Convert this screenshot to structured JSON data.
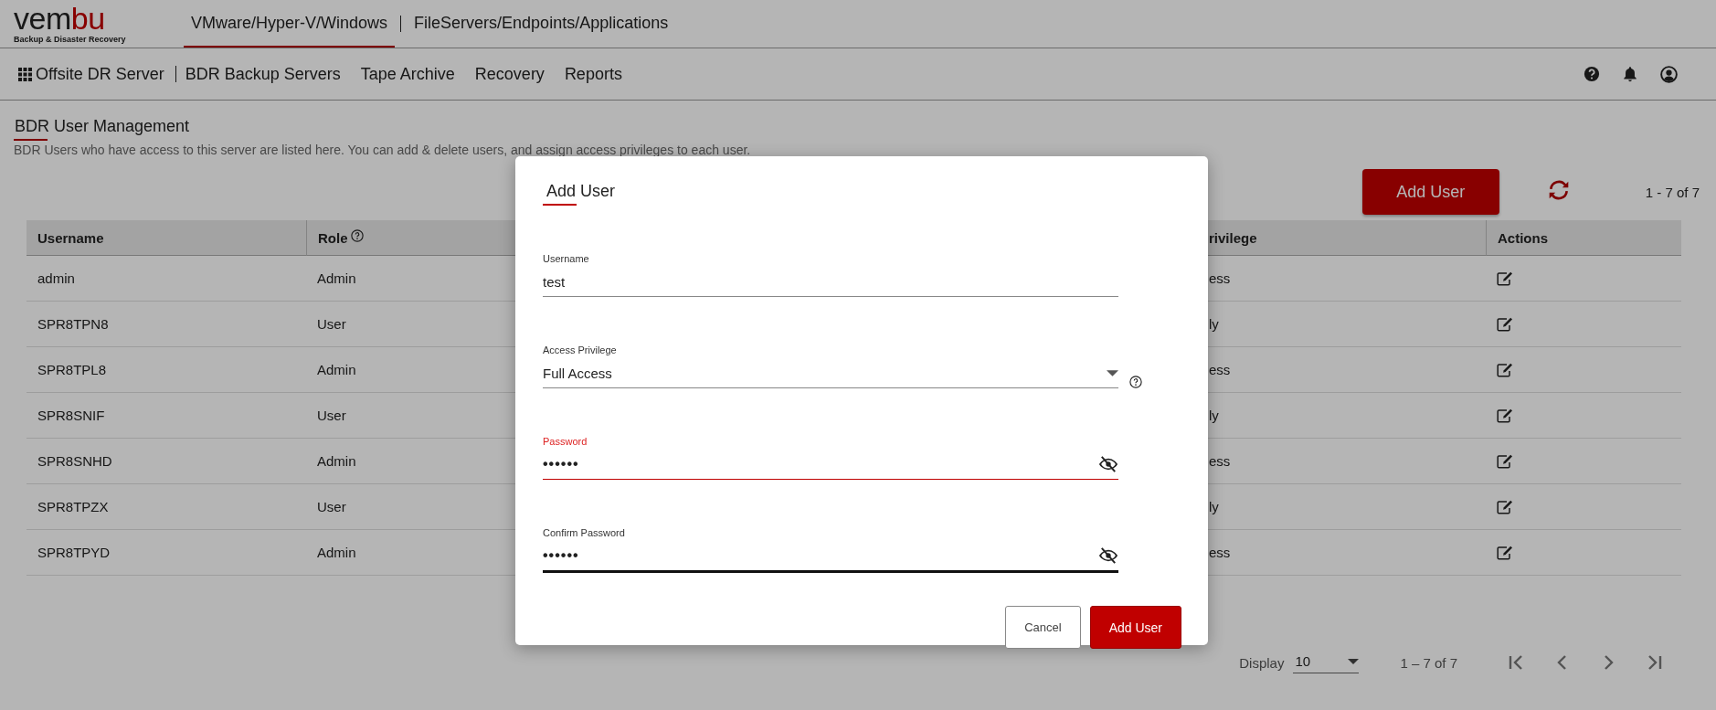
{
  "header": {
    "logo": {
      "parts": [
        "vem",
        "bu"
      ],
      "tagline": "Backup & Disaster Recovery"
    },
    "product_tabs": [
      {
        "label": "VMware/Hyper-V/Windows",
        "selected": true
      },
      {
        "label": "FileServers/Endpoints/Applications",
        "selected": false
      }
    ]
  },
  "nav": {
    "server": "Offsite DR Server",
    "items": [
      "BDR Backup Servers",
      "Tape Archive",
      "Recovery",
      "Reports"
    ]
  },
  "page": {
    "title": "BDR User Management",
    "description": "BDR Users who have access to this server are listed here. You can add & delete users, and assign access privileges to each user.",
    "add_button": "Add User",
    "count": "1 - 7 of 7"
  },
  "table": {
    "columns": [
      {
        "label": "Username",
        "help": false
      },
      {
        "label": "Role",
        "help": true
      },
      {
        "label": "rivilege",
        "help": false
      },
      {
        "label": "Actions",
        "help": false
      }
    ],
    "rows": [
      {
        "username": "admin",
        "role": "Admin",
        "column_3": "ess"
      },
      {
        "username": "SPR8TPN8",
        "role": "User",
        "column_3": "ly"
      },
      {
        "username": "SPR8TPL8",
        "role": "Admin",
        "column_3": "ess"
      },
      {
        "username": "SPR8SNIF",
        "role": "User",
        "column_3": "ly"
      },
      {
        "username": "SPR8SNHD",
        "role": "Admin",
        "column_3": "ess"
      },
      {
        "username": "SPR8TPZX",
        "role": "User",
        "column_3": "ly"
      },
      {
        "username": "SPR8TPYD",
        "role": "Admin",
        "column_3": "ess"
      }
    ]
  },
  "pagination": {
    "label": "Display",
    "page_size": "10",
    "range": "1 – 7 of 7"
  },
  "dialog": {
    "title": "Add User",
    "fields": [
      {
        "kind": "text",
        "label": "Username",
        "value": "test",
        "invalid": false,
        "focused": false
      },
      {
        "kind": "select",
        "label": "Access Privilege",
        "value": "Full Access",
        "invalid": false,
        "focused": false
      },
      {
        "kind": "password",
        "label": "Password",
        "value": "••••••",
        "invalid": true,
        "focused": false
      },
      {
        "kind": "password",
        "label": "Confirm Password",
        "value": "••••••",
        "invalid": false,
        "focused": true
      }
    ],
    "buttons": [
      {
        "label": "Cancel",
        "primary": false
      },
      {
        "label": "Add User",
        "primary": true
      }
    ]
  }
}
